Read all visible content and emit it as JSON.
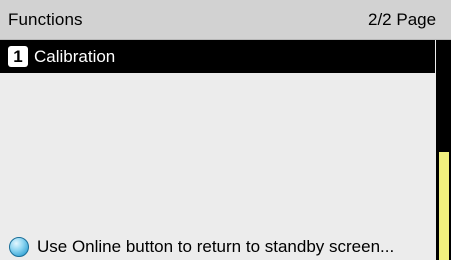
{
  "header": {
    "title": "Functions",
    "page_indicator": "2/2 Page"
  },
  "menu": {
    "items": [
      {
        "number": "1",
        "label": "Calibration",
        "selected": true
      }
    ]
  },
  "status": {
    "icon": "online-button-icon",
    "message": "Use Online button to return to standby screen..."
  },
  "colors": {
    "title_bar": "#d2d2d2",
    "background": "#ececec",
    "selection": "#000000",
    "scroll_thumb": "#f1f07e",
    "online_icon": "#3aa6d6"
  }
}
